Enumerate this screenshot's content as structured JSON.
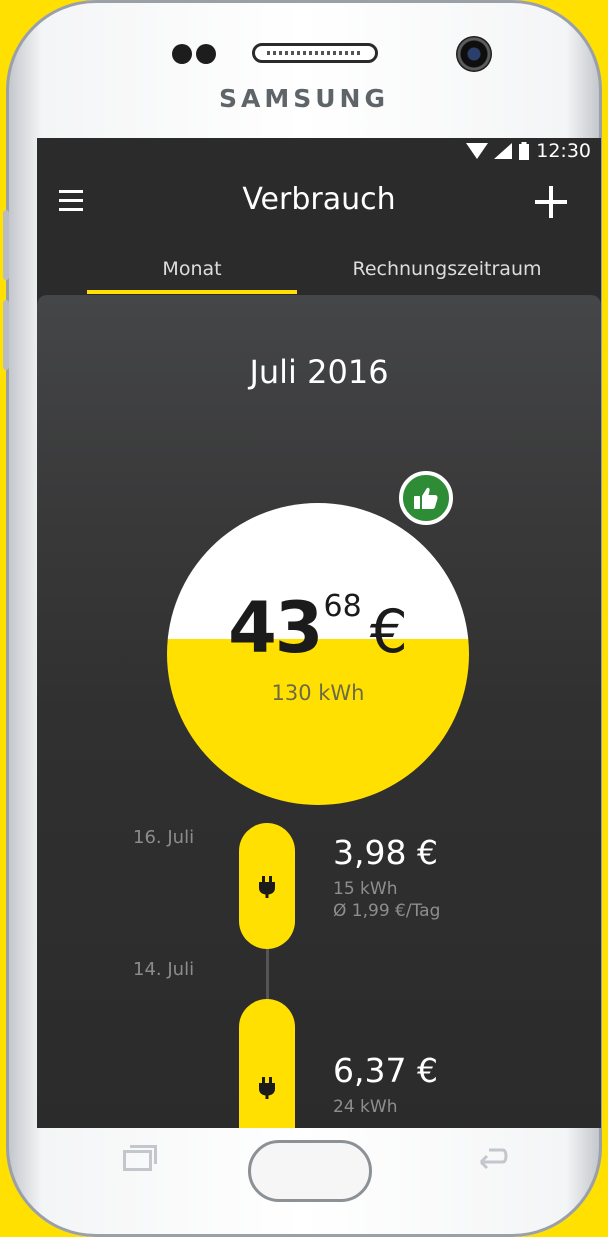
{
  "device": {
    "brand": "SAMSUNG"
  },
  "status_bar": {
    "time": "12:30"
  },
  "app_bar": {
    "title": "Verbrauch",
    "menu_icon": "hamburger-menu-icon",
    "add_icon": "plus-icon"
  },
  "tabs": [
    {
      "label": "Monat",
      "active": true
    },
    {
      "label": "Rechnungszeitraum",
      "active": false
    }
  ],
  "summary": {
    "period": "Juli 2016",
    "amount_int": "43",
    "amount_dec": "68",
    "currency": "€",
    "energy": "130 kWh",
    "badge_icon": "thumbs-up-icon"
  },
  "entries": [
    {
      "date": "16. Juli",
      "amount": "3,98 €",
      "energy": "15 kWh",
      "average": "Ø 1,99 €/Tag"
    },
    {
      "date": "14. Juli",
      "amount": "6,37 €",
      "energy": "24 kWh"
    }
  ],
  "colors": {
    "accent": "#ffe000",
    "background": "#2b2b2b",
    "badge": "#2e8b36"
  }
}
